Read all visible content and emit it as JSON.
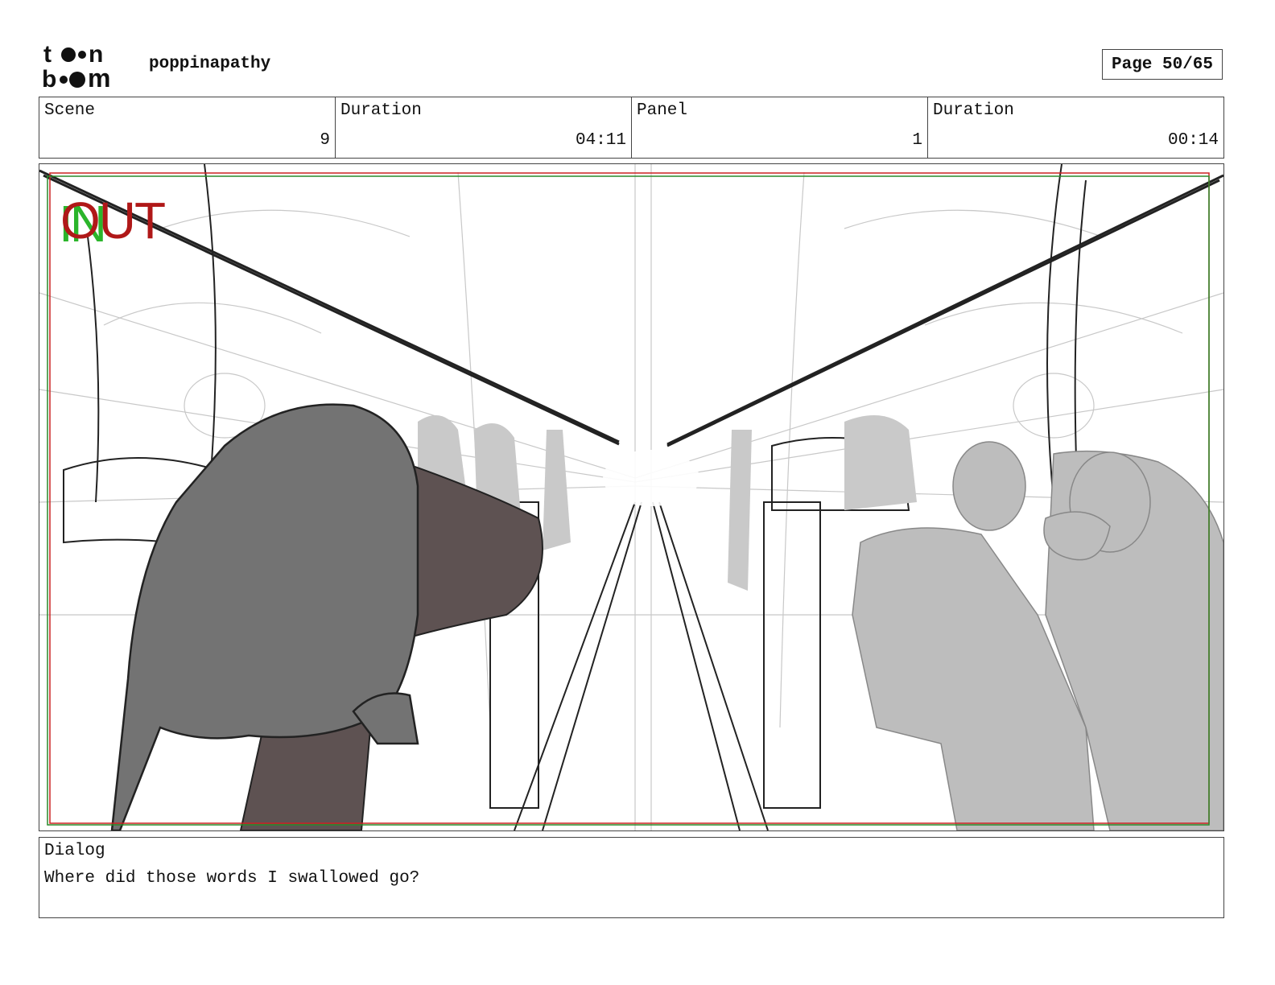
{
  "header": {
    "logo_text": "toon boom",
    "project": "poppinapathy",
    "page": "Page 50/65"
  },
  "info": {
    "scene_label": "Scene",
    "scene_value": "9",
    "scene_duration_label": "Duration",
    "scene_duration_value": "04:11",
    "panel_label": "Panel",
    "panel_value": "1",
    "panel_duration_label": "Duration",
    "panel_duration_value": "00:14"
  },
  "panel": {
    "in_marker": "IN",
    "out_marker": "OUT",
    "colors": {
      "in": "#2bb52b",
      "out": "#b01818",
      "safe_red": "#cc2222",
      "safe_green": "#2a8a2a"
    }
  },
  "dialog": {
    "label": "Dialog",
    "text": "Where did those words I swallowed go?"
  }
}
